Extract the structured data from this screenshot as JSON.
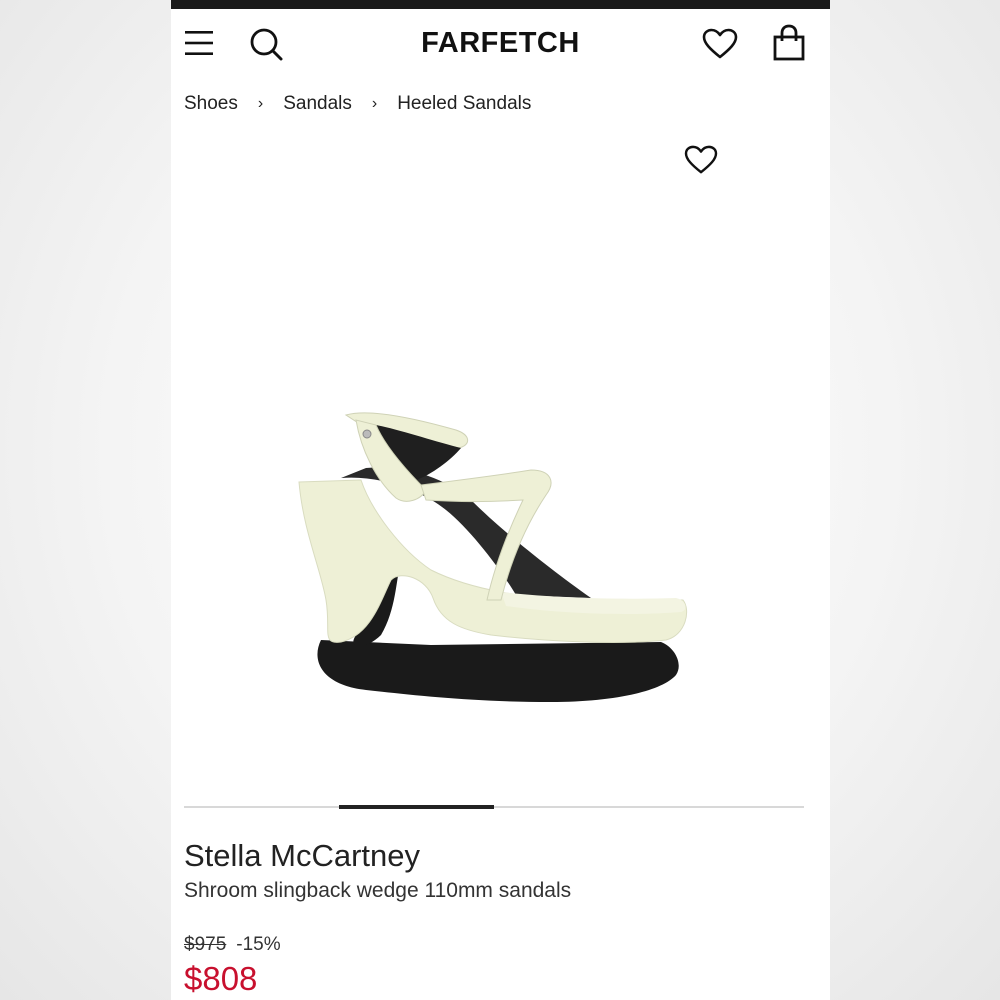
{
  "header": {
    "logo": "FARFETCH",
    "menu_icon": "hamburger-menu-icon",
    "search_icon": "search-icon",
    "wishlist_icon": "heart-icon",
    "bag_icon": "shopping-bag-icon"
  },
  "breadcrumb": {
    "items": [
      "Shoes",
      "Sandals",
      "Heeled Sandals"
    ],
    "separator": "›"
  },
  "gallery": {
    "favorite_icon": "heart-outline-icon",
    "image_alt": "product-image-sandal",
    "progress": 0.25
  },
  "product": {
    "brand": "Stella McCartney",
    "name": "Shroom slingback wedge 110mm sandals",
    "original_price": "$975",
    "discount": "-15%",
    "sale_price": "$808"
  },
  "colors": {
    "sale_price": "#c8102e",
    "text": "#222222",
    "sandal_cream": "#eef0d6"
  }
}
